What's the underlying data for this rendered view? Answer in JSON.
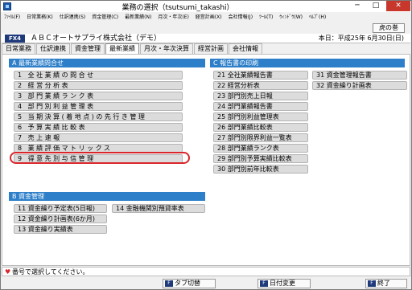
{
  "window": {
    "title": "業務の選択（tsutsumi_takashi）",
    "minimize": "─",
    "maximize": "□",
    "close": "✕"
  },
  "menu": [
    "ﾌｧｲﾙ(F)",
    "日常業務(K)",
    "仕訳連携(S)",
    "資金管理(C)",
    "最新業績(N)",
    "月次・年次(E)",
    "経営計画(X)",
    "会社情報(J)",
    "ﾂｰﾙ(T)",
    "ｳｨﾝﾄﾞｳ(W)",
    "ﾍﾙﾌﾟ(H)"
  ],
  "toolbar": {
    "tora_label": "虎の巻"
  },
  "company": {
    "code": "FX4",
    "name": "ＡＢＣオートサプライ株式会社（デモ）",
    "today": "本日：平成25年 6月30日(日)"
  },
  "tabs": [
    "日常業務",
    "仕訳連携",
    "資金管理",
    "最新業績",
    "月次・年次決算",
    "経営計画",
    "会社情報"
  ],
  "sections": {
    "a_title": "A 最新業績問合せ",
    "c_title": "C 報告書の印刷",
    "b_title": "B 資金管理"
  },
  "section_a_items": [
    "1 全社業績の問合せ",
    "2 経営分析表",
    "3 部門業績ランク表",
    "4 部門別利益管理表",
    "5 当期決算(着地点)の先行き管理",
    "6 予算実績比較表",
    "7 売上速報",
    "8 業績評価マトリックス",
    "9 得意先別与信管理"
  ],
  "section_c_items_col1": [
    "21 全社業績報告書",
    "22 経営分析表",
    "23 部門別売上日報",
    "24 部門業績報告書",
    "25 部門別利益管理表",
    "26 部門業績比較表",
    "27 部門別限界利益一覧表",
    "28 部門業績ランク表",
    "29 部門別予算実績比較表",
    "30 部門別前年比較表"
  ],
  "section_c_items_col2": [
    "31 資金管理報告書",
    "32 資金繰り計画表"
  ],
  "section_b_items_col1": [
    "11 資金繰り予定表(5日報)",
    "12 資金繰り計画表(6か月)",
    "13 資金繰り実績表"
  ],
  "section_b_items_col2": [
    "14 金融機関別預貸率表"
  ],
  "status": {
    "message": "番号で選択してください。"
  },
  "fkeys": [
    {
      "key": "F",
      "label": "タブ切替"
    },
    {
      "key": "F",
      "label": "日付変更"
    },
    {
      "key": "F",
      "label": "終了"
    }
  ],
  "colors": {
    "section_header": "#2e7fc9",
    "highlight_ring": "#d9262b",
    "fx4_badge": "#1f3a7a"
  }
}
